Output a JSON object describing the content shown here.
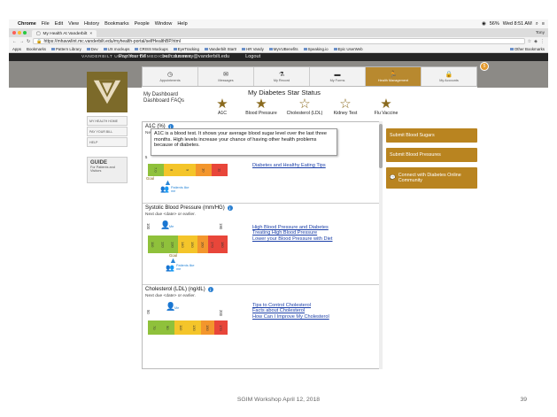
{
  "menubar": {
    "app": "Chrome",
    "items": [
      "File",
      "Edit",
      "View",
      "History",
      "Bookmarks",
      "People",
      "Window",
      "Help"
    ],
    "battery": "56%",
    "clock": "Wed 8:51 AM"
  },
  "browser": {
    "tab_title": "My Health At Vanderbilt",
    "user": "Tony",
    "url": "https://mhavwlint.mc.vanderbilt.edu/myhealth-portal/selfHealthBP.html",
    "bookmarks": [
      "Apps",
      "Bookmarks",
      "Pattern Library",
      "Dev",
      "UX mockups",
      "CRISS Mockups",
      "EyeTracking",
      "Vanderbilt Start!",
      "HR Vandy",
      "MyVUBenefits",
      "Speaking.io",
      "Epic UserWeb"
    ],
    "other_bookmarks": "Other Bookmarks"
  },
  "portal": {
    "header_title": "VANDERBILT UNIVERSITY MEDICAL CENTER",
    "header_links": [
      "Pay Your Bill",
      "beth.dunaway@vanderbilt.edu",
      "Logout"
    ],
    "sidenav": [
      "MY HEALTH HOME",
      "PAY YOUR BILL",
      "HELP"
    ],
    "guide_title": "GUIDE",
    "guide_sub": "For Patients and Visitors",
    "nav": [
      {
        "label": "Appointments",
        "icon": "clock-icon"
      },
      {
        "label": "Messages",
        "icon": "envelope-icon"
      },
      {
        "label": "My Record",
        "icon": "flask-icon"
      },
      {
        "label": "My Forms",
        "icon": "folder-icon"
      },
      {
        "label": "Health Management",
        "icon": "runner-icon"
      },
      {
        "label": "My Accounts",
        "icon": "lock-icon"
      }
    ],
    "notification_count": "5",
    "dashboard_links": [
      "My Dashboard",
      "Dashboard FAQs"
    ],
    "stars_title": "My Diabetes Star Status",
    "stars": [
      {
        "label": "A1C",
        "filled": true
      },
      {
        "label": "Blood Pressure",
        "filled": true
      },
      {
        "label": "Cholesterol (LDL)",
        "filled": false
      },
      {
        "label": "Kidney Test",
        "filled": false
      },
      {
        "label": "Flu Vaccine",
        "filled": true
      }
    ],
    "side_buttons": [
      "Submit Blood Sugars",
      "Submit Blood Pressures",
      "Connect with Diabetes Online Community"
    ],
    "a1c": {
      "title": "A1C (%)",
      "next_due": "Next due",
      "tooltip": "A1C is a blood test.  It shows your average blood sugar level over the last three months.  High levels increase your chance of having other health problems because of diabetes.",
      "link": "Diabetes and Healthy Eating Tips",
      "goal": "Goal",
      "patients_like_me": "Patients like me",
      "scale_start": "5",
      "visible_ticks": [
        "7.0",
        "8",
        "9",
        "10",
        "11"
      ]
    },
    "bp": {
      "title": "Systolic Blood Pressure (mm/HG)",
      "next_due": "Next due <date> or earlier.",
      "me": "Me",
      "goal": "Goal",
      "patients_like_me": "Patients like me",
      "scale_min": "100",
      "scale_max": "190",
      "ticks": [
        "110",
        "120",
        "130",
        "140",
        "150",
        "160",
        "170",
        "180"
      ],
      "links": [
        "High Blood Pressure and Diabetes",
        "Treating High Blood Pressure",
        "Lower your Blood Pressure with Diet"
      ]
    },
    "ldl": {
      "title": "Cholesterol (LDL) (ng/dL)",
      "next_due": "Next due <date> or earlier.",
      "me": "Me",
      "scale_min": "50",
      "scale_max": "200",
      "ticks": [
        "70",
        "90",
        "110",
        "130",
        "150",
        "170"
      ],
      "links": [
        "Tips to Control Cholesterol",
        "Facts about Cholesterol",
        "How Can I Improve My Cholesterol"
      ]
    }
  },
  "slide": {
    "footer": "SGIM Workshop April 12, 2018",
    "page": "39"
  }
}
